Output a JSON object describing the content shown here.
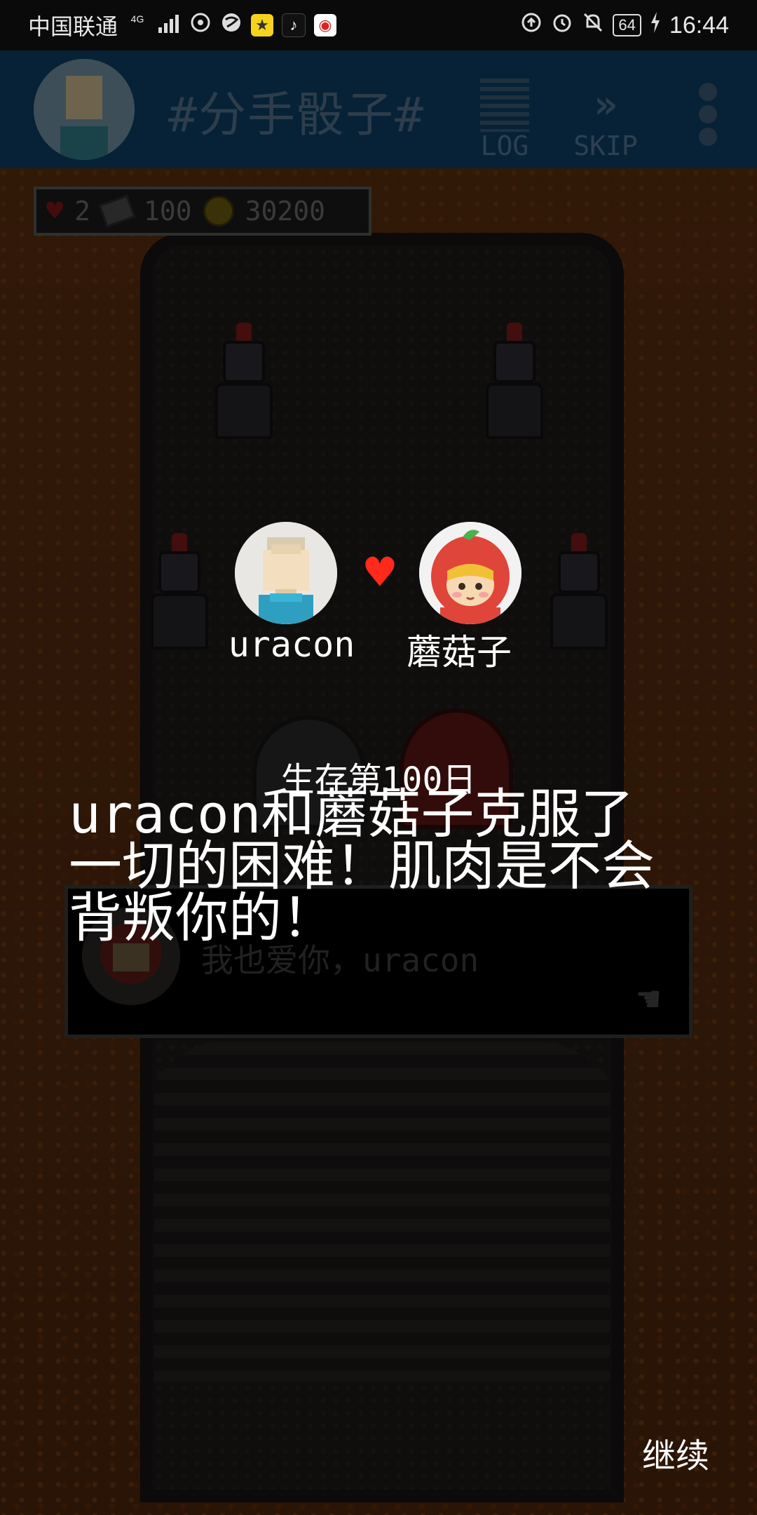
{
  "status_bar": {
    "carrier": "中国联通",
    "network": "4G",
    "battery": "64",
    "time": "16:44"
  },
  "top_bar": {
    "title": "#分手骰子#",
    "log_label": "LOG",
    "skip_label": "SKIP"
  },
  "hud": {
    "lives": "2",
    "tickets": "100",
    "coins": "30200"
  },
  "dialog": {
    "text": "我也爱你，uracon"
  },
  "couple": {
    "left_name": "uracon",
    "right_name": "蘑菇子"
  },
  "victory": {
    "title": "生存第100日",
    "message": "uracon和蘑菇子克服了一切的困难！肌肉是不会背叛你的！"
  },
  "continue_label": "继续",
  "colors": {
    "top_bar": "#0d3e63",
    "heart": "#ff2a1a",
    "text": "#ffffff"
  },
  "icons": {
    "log": "log-lines-icon",
    "skip": "double-chevron-icon",
    "menu": "vertical-dots-icon",
    "heart": "pixel-heart-icon",
    "pointer": "hand-pointer-icon"
  }
}
